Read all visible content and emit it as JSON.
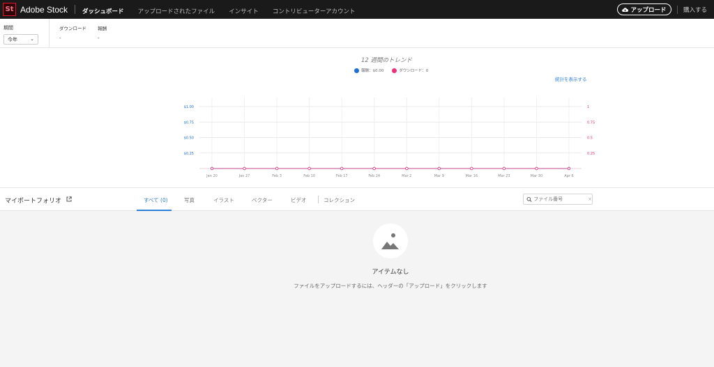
{
  "header": {
    "logo_mark": "St",
    "brand": "Adobe Stock",
    "nav": [
      {
        "label": "ダッシュボード",
        "active": true
      },
      {
        "label": "アップロードされたファイル",
        "active": false
      },
      {
        "label": "インサイト",
        "active": false
      },
      {
        "label": "コントリビューターアカウント",
        "active": false
      }
    ],
    "upload_label": "アップロード",
    "buy_label": "購入する"
  },
  "stats": {
    "period_label": "期間",
    "period_value": "今年",
    "downloads_label": "ダウンロード",
    "downloads_value": "-",
    "earnings_label": "報酬",
    "earnings_value": "-"
  },
  "chart": {
    "show_stats_link": "統計を表示する"
  },
  "chart_data": {
    "type": "line",
    "title": "12 週間のトレンド",
    "legend": [
      {
        "label": "報酬：$0.00",
        "color": "#1f6fd6"
      },
      {
        "label": "ダウンロード：0",
        "color": "#e8337a"
      }
    ],
    "legend_position": "top-center",
    "grid": true,
    "categories": [
      "Jan 20",
      "Jan 27",
      "Feb 3",
      "Feb 10",
      "Feb 17",
      "Feb 24",
      "Mar 2",
      "Mar 9",
      "Mar 16",
      "Mar 23",
      "Mar 30",
      "Apr 6"
    ],
    "y_left": {
      "ticks": [
        "$0.25",
        "$0.50",
        "$0.75",
        "$1.00"
      ],
      "range": [
        0,
        1
      ],
      "color": "#1f6fd6"
    },
    "y_right": {
      "ticks": [
        "0.25",
        "0.5",
        "0.75",
        "1"
      ],
      "range": [
        0,
        1
      ],
      "color": "#e8337a"
    },
    "series": [
      {
        "name": "報酬",
        "axis": "left",
        "values": [
          0,
          0,
          0,
          0,
          0,
          0,
          0,
          0,
          0,
          0,
          0,
          0
        ],
        "color": "#1f6fd6"
      },
      {
        "name": "ダウンロード",
        "axis": "right",
        "values": [
          0,
          0,
          0,
          0,
          0,
          0,
          0,
          0,
          0,
          0,
          0,
          0
        ],
        "color": "#e8337a"
      }
    ]
  },
  "portfolio": {
    "title": "マイポートフォリオ",
    "tabs": [
      "すべて (0)",
      "写真",
      "イラスト",
      "ベクター",
      "ビデオ",
      "コレクション"
    ],
    "active_tab": 0,
    "search_placeholder": "ファイル番号"
  },
  "empty_state": {
    "title": "アイテムなし",
    "description": "ファイルをアップロードするには、ヘッダーの「アップロード」をクリックします"
  }
}
